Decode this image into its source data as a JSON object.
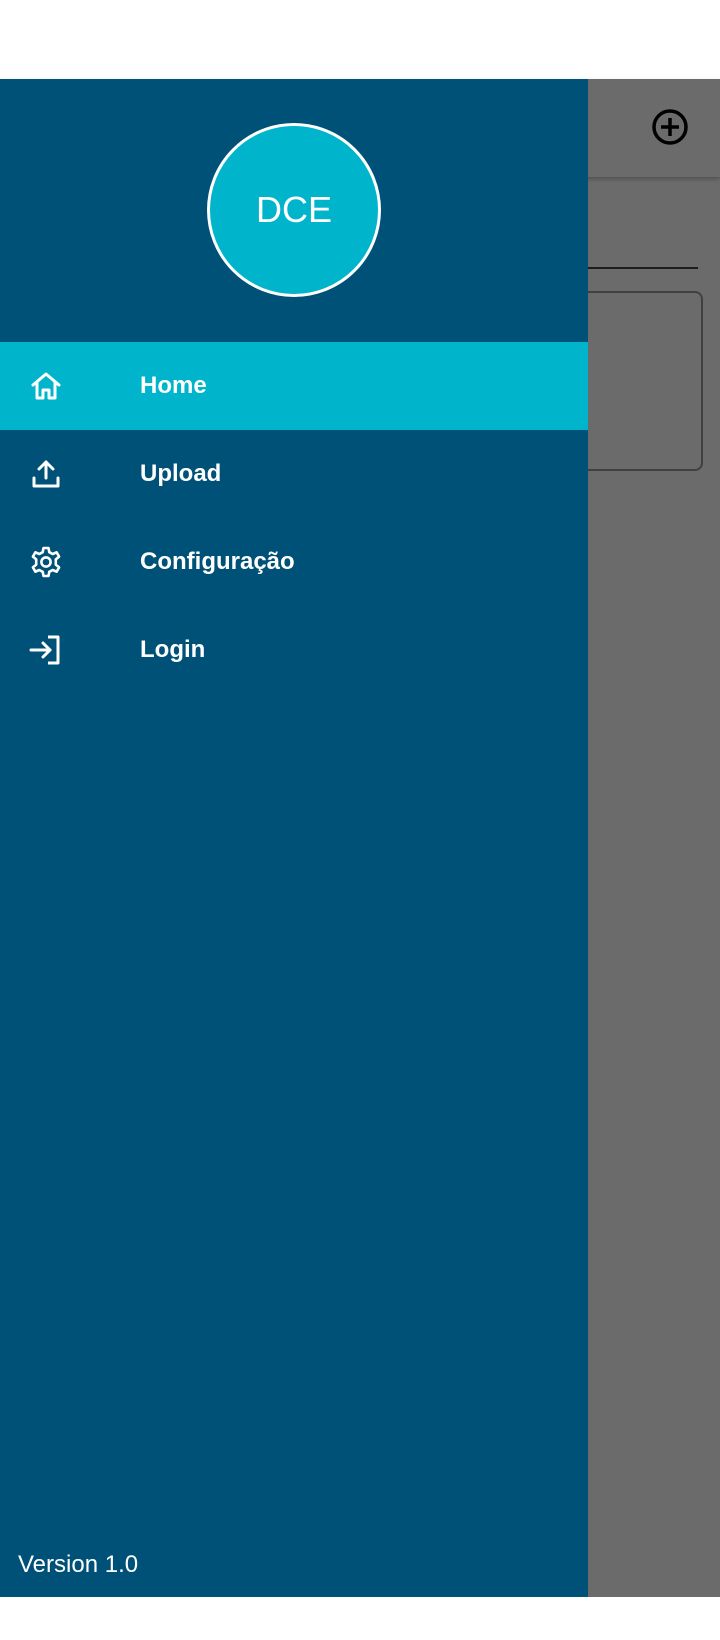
{
  "drawer": {
    "avatar_initials": "DCE",
    "menu": [
      {
        "label": "Home",
        "icon": "home-icon",
        "active": true
      },
      {
        "label": "Upload",
        "icon": "upload-icon",
        "active": false
      },
      {
        "label": "Configuração",
        "icon": "gear-icon",
        "active": false
      },
      {
        "label": "Login",
        "icon": "login-icon",
        "active": false
      }
    ],
    "version": "Version 1.0"
  },
  "colors": {
    "drawer_bg": "#005177",
    "accent": "#00b4cc",
    "text": "#ffffff"
  },
  "app": {
    "toolbar_action_icon": "add-circle-icon"
  }
}
